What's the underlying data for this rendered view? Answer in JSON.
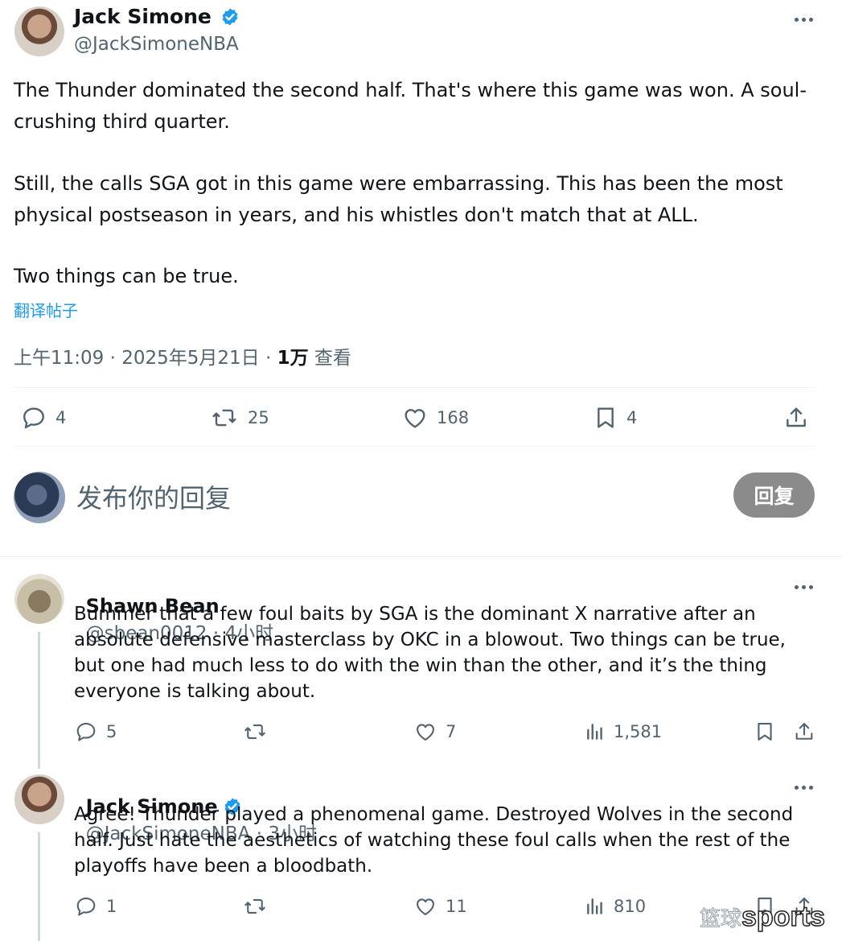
{
  "tweet": {
    "author_name": "Jack Simone",
    "author_handle": "@JackSimoneNBA",
    "paragraphs": [
      "The Thunder dominated the second half. That's where this game was won. A soul-crushing third quarter.",
      "Still, the calls SGA got in this game were embarrassing. This has been the most physical postseason in years, and his whistles don't match that at ALL.",
      "Two things can be true."
    ],
    "translate_label": "翻译帖子",
    "timestamp": "上午11:09 · 2025年5月21日 · ",
    "views_count": "1万",
    "views_label": " 查看",
    "stats": {
      "replies": "4",
      "reposts": "25",
      "likes": "168",
      "bookmarks": "4"
    }
  },
  "composer": {
    "placeholder": "发布你的回复",
    "button_label": "回复"
  },
  "replies": [
    {
      "author_name": "Shawn Bean",
      "author_handle": "@sbean0012",
      "time": " · 4小时",
      "text": "Bummer that a few foul baits by SGA is the dominant X narrative after an absolute defensive masterclass by OKC in a blowout.  Two things can be true, but one had much less to do with the win than the other, and it’s the thing everyone is talking about.",
      "replies": "5",
      "reposts": "",
      "likes": "7",
      "views": "1,581"
    },
    {
      "author_name": "Jack Simone",
      "author_handle": "@JackSimoneNBA",
      "time": " · 3小时",
      "text": "Agree! Thunder played a phenomenal game. Destroyed Wolves in the second half. Just hate the aesthetics of watching these foul calls when the rest of the playoffs have been a bloodbath.",
      "replies": "1",
      "reposts": "",
      "likes": "11",
      "views": "810"
    }
  ],
  "watermark": {
    "prefix": "篮球",
    "brand": "sports"
  },
  "colors": {
    "verified": "#1d9bf0",
    "muted": "#536471",
    "button_bg": "#8b8b8b",
    "link": "#1d9bf0"
  },
  "icons": [
    "more-icon",
    "reply-icon",
    "repost-icon",
    "like-icon",
    "bookmark-icon",
    "share-icon",
    "views-icon",
    "verified-icon"
  ]
}
